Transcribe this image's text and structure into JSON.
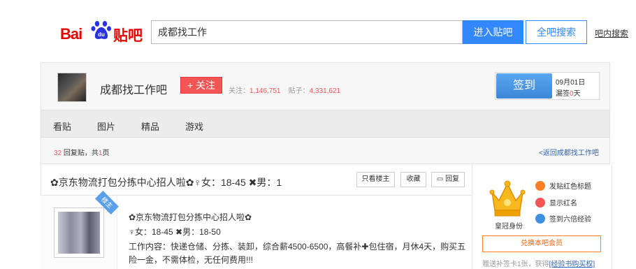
{
  "header": {
    "logo_left": "Bai",
    "logo_mid": "du",
    "logo_right": "贴吧",
    "search_value": "成都找工作",
    "enter_label": "进入贴吧",
    "all_label": "全吧搜索",
    "inbar_label": "吧内搜索"
  },
  "forum": {
    "name": "成都找工作吧",
    "follow_label": "+ 关注",
    "followers_label": "关注：",
    "followers": "1,146,751",
    "posts_label": "贴子：",
    "posts": "4,331,621",
    "signin_label": "签到",
    "date": "09月01日",
    "missed_prefix": "漏签",
    "missed_days": "0",
    "missed_suffix": "天"
  },
  "nav": {
    "items": [
      "看贴",
      "图片",
      "精品",
      "游戏"
    ]
  },
  "pager": {
    "count": "32",
    "count_suffix": " 回复贴，共",
    "pages": "1",
    "pages_suffix": "页",
    "back_label": "<返回成都找工作吧"
  },
  "thread": {
    "title": "✿京东物流打包分拣中心招人啦✿♀女：18-45 ✖男：1",
    "only_op_label": "只看楼主",
    "collect_label": "收藏",
    "reply_label": "回复"
  },
  "post": {
    "badge": "楼主",
    "line1": "✿京东物流打包分拣中心招人啦✿",
    "line2": "♀女：18-45 ✖男：18-50",
    "line3": "工作内容：快递仓储、分拣、装卸，综合薪4500-6500，高餐补✚包住宿，月休4天，购买五",
    "line4": "险一金，不需体检，无任何费用!!!"
  },
  "side": {
    "crown_label": "皇冠身份",
    "perks": [
      "发贴红色标题",
      "显示红名",
      "签到六倍经验"
    ],
    "perk_colors": [
      "#ff7f27",
      "#f35454",
      "#3d8fe0"
    ],
    "vip_label": "兑换本吧会员",
    "note_prefix": "赠送补签卡1张，获得",
    "note_link": "[经验书购买权]"
  }
}
